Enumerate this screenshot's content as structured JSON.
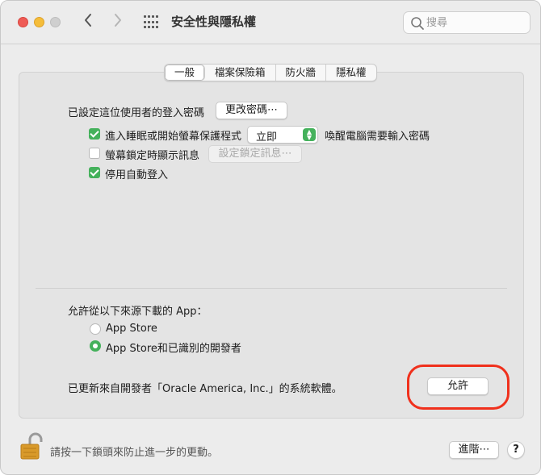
{
  "window": {
    "title": "安全性與隱私權",
    "search_placeholder": "搜尋"
  },
  "tabs": [
    {
      "label": "一般",
      "active": true
    },
    {
      "label": "檔案保險箱",
      "active": false
    },
    {
      "label": "防火牆",
      "active": false
    },
    {
      "label": "隱私權",
      "active": false
    }
  ],
  "general": {
    "password_label": "已設定這位使用者的登入密碼",
    "change_password_button": "更改密碼⋯",
    "require_password": {
      "checked": true,
      "label": "進入睡眠或開始螢幕保護程式",
      "select_value": "立即",
      "suffix": "喚醒電腦需要輸入密碼"
    },
    "show_message": {
      "checked": false,
      "label": "螢幕鎖定時顯示訊息",
      "button": "設定鎖定訊息⋯"
    },
    "disable_autologin": {
      "checked": true,
      "label": "停用自動登入"
    }
  },
  "downloads": {
    "heading": "允許從以下來源下載的 App：",
    "options": [
      {
        "label": "App Store",
        "selected": false
      },
      {
        "label": "App Store和已識別的開發者",
        "selected": true
      }
    ],
    "blocked_message": "已更新來自開發者「Oracle America, Inc.」的系統軟體。",
    "allow_button": "允許"
  },
  "footer": {
    "lock_message": "請按一下鎖頭來防止進一步的更動。",
    "advanced_button": "進階⋯",
    "help_label": "?"
  },
  "colors": {
    "accent": "#44b15b",
    "highlight": "#f0301c",
    "close": "#ee5b55",
    "minimize": "#f5bd3a"
  }
}
